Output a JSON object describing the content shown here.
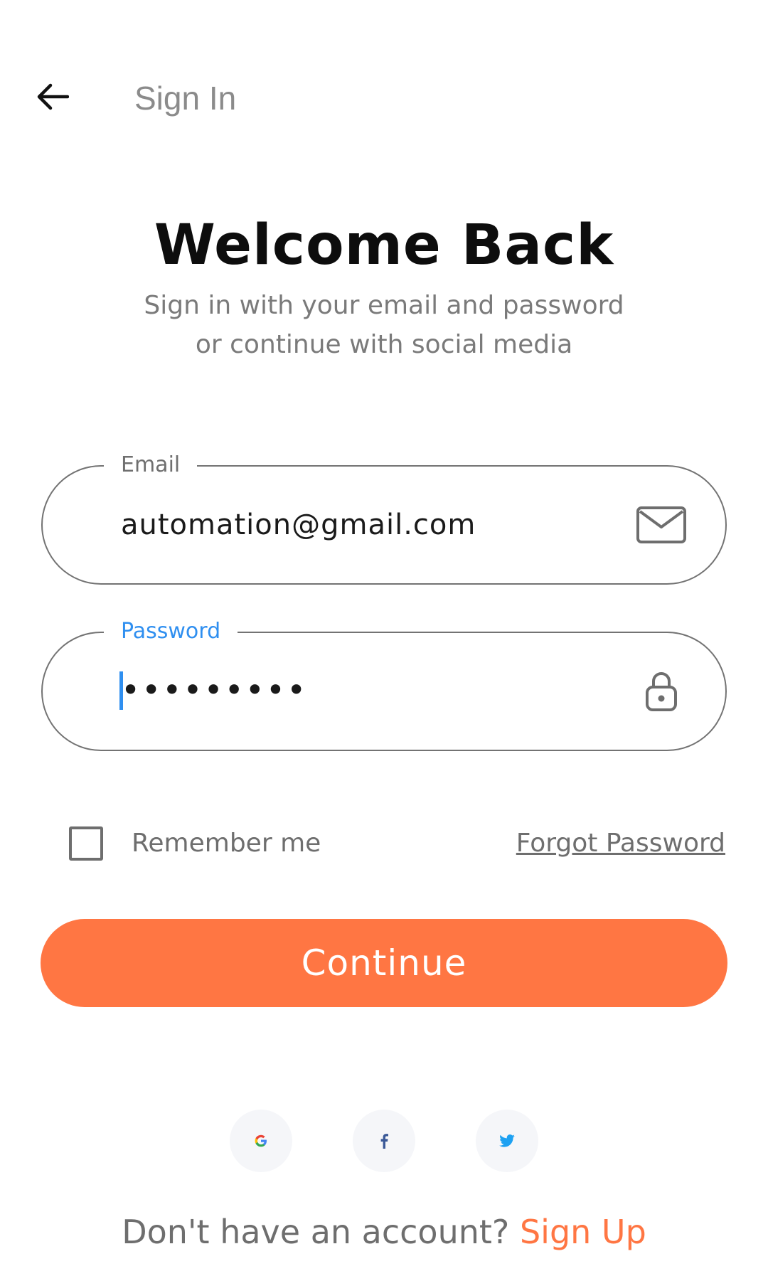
{
  "appbar": {
    "title": "Sign In",
    "back_icon": "arrow-left-icon"
  },
  "heading": {
    "title": "Welcome Back",
    "subtitle_line1": "Sign in with your email and password",
    "subtitle_line2": "or continue with social media"
  },
  "form": {
    "email": {
      "label": "Email",
      "value": "automation@gmail.com",
      "icon": "mail-icon"
    },
    "password": {
      "label": "Password",
      "value": "•••••••••",
      "icon": "lock-icon"
    },
    "remember_label": "Remember me",
    "remember_checked": false,
    "forgot_label": "Forgot Password",
    "continue_label": "Continue"
  },
  "social": [
    {
      "name": "google",
      "icon": "google-icon"
    },
    {
      "name": "facebook",
      "icon": "facebook-icon"
    },
    {
      "name": "twitter",
      "icon": "twitter-icon"
    }
  ],
  "footer": {
    "prompt": "Don't have an account?",
    "signup_label": "Sign Up"
  },
  "colors": {
    "accent": "#ff7643",
    "focus": "#2f8ff0",
    "muted_text": "#7a7a7a",
    "social_bg": "#f5f6f9"
  }
}
